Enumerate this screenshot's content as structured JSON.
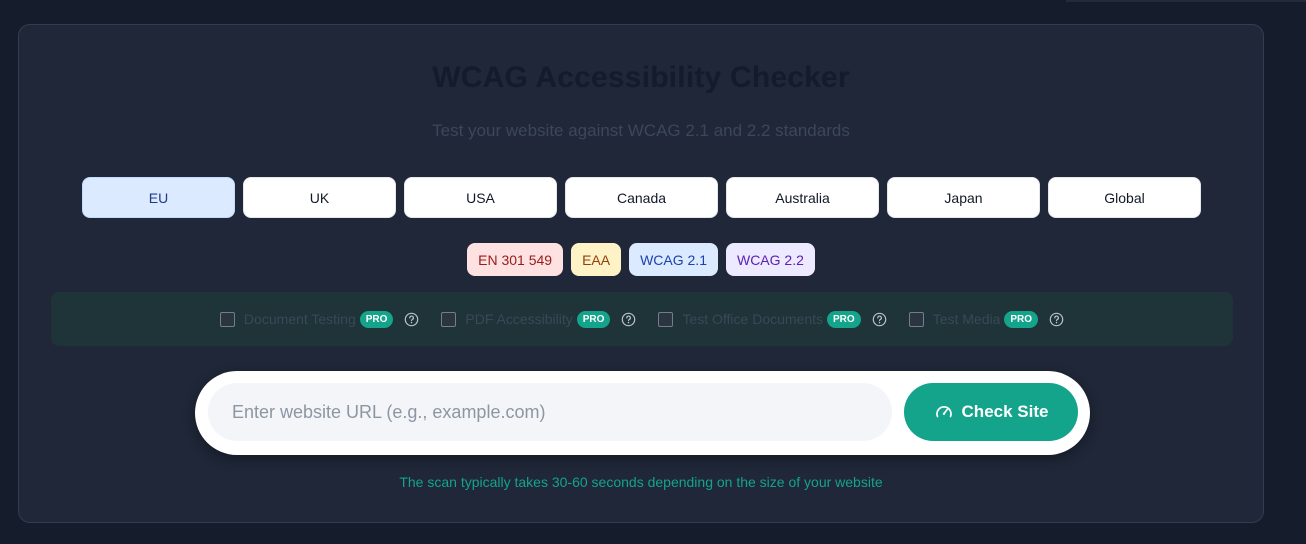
{
  "header": {
    "title": "WCAG Accessibility Checker",
    "subtitle": "Test your website against WCAG 2.1 and 2.2 standards"
  },
  "regions": {
    "selected": "EU",
    "items": [
      {
        "label": "EU"
      },
      {
        "label": "UK"
      },
      {
        "label": "USA"
      },
      {
        "label": "Canada"
      },
      {
        "label": "Australia"
      },
      {
        "label": "Japan"
      },
      {
        "label": "Global"
      }
    ]
  },
  "standards": [
    {
      "label": "EN 301 549",
      "bg": "#fee2e2",
      "color": "#991b1b"
    },
    {
      "label": "EAA",
      "bg": "#fef3c7",
      "color": "#92400e"
    },
    {
      "label": "WCAG 2.1",
      "bg": "#dbeafe",
      "color": "#1e40af"
    },
    {
      "label": "WCAG 2.2",
      "bg": "#ede9fe",
      "color": "#5b21b6"
    }
  ],
  "options": [
    {
      "label": "Document Testing",
      "badge": "PRO",
      "checked": false,
      "help_icon": "help-circle-icon"
    },
    {
      "label": "PDF Accessibility",
      "badge": "PRO",
      "checked": false,
      "help_icon": "help-circle-icon"
    },
    {
      "label": "Test Office Documents",
      "badge": "PRO",
      "checked": false,
      "help_icon": "help-circle-icon"
    },
    {
      "label": "Test Media",
      "badge": "PRO",
      "checked": false,
      "help_icon": "help-circle-icon"
    }
  ],
  "search": {
    "placeholder": "Enter website URL (e.g., example.com)",
    "value": "",
    "button_label": "Check Site",
    "button_icon": "speedometer-icon"
  },
  "note": "The scan typically takes 30-60 seconds depending on the size of your website",
  "colors": {
    "accent": "#14a38b",
    "page_bg": "#151c2c",
    "card_bg": "#1f2738",
    "active_region_bg": "#dbeafe"
  }
}
